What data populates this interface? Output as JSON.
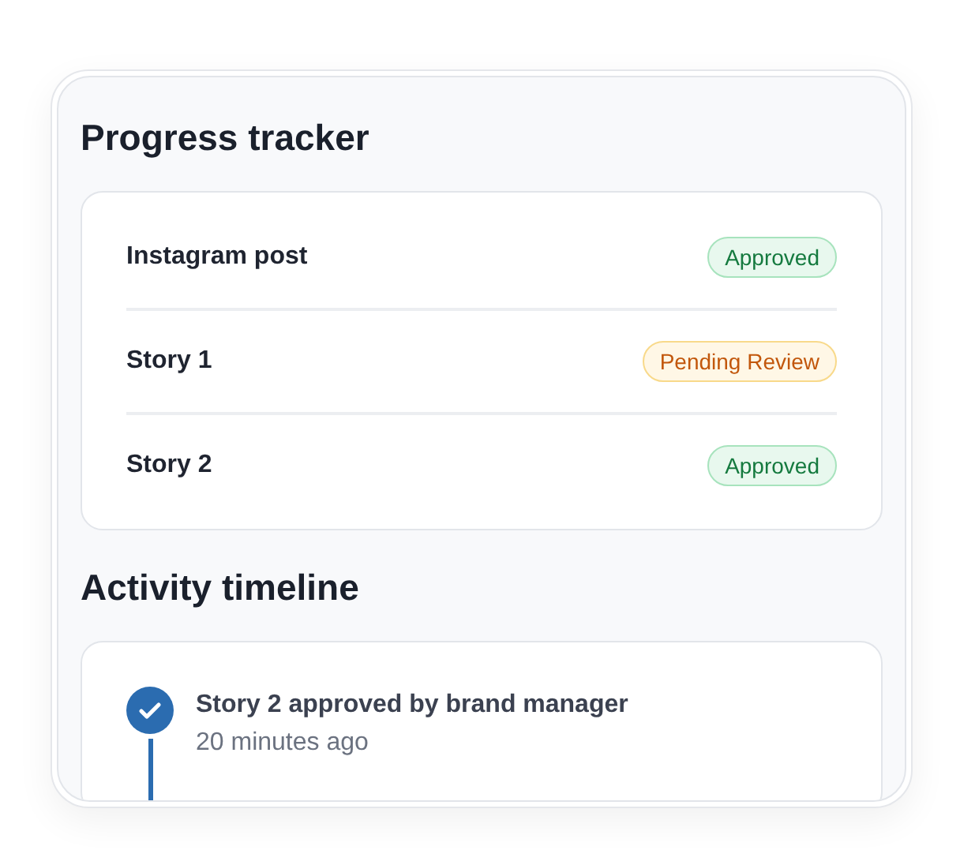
{
  "progress_tracker": {
    "title": "Progress tracker",
    "items": [
      {
        "name": "Instagram post",
        "status": {
          "kind": "approved",
          "label": "Approved"
        }
      },
      {
        "name": "Story 1",
        "status": {
          "kind": "pending",
          "label": "Pending Review"
        }
      },
      {
        "name": "Story 2",
        "status": {
          "kind": "approved",
          "label": "Approved"
        }
      }
    ]
  },
  "activity_timeline": {
    "title": "Activity timeline",
    "events": [
      {
        "kind": "done",
        "text": "Story 2 approved by brand manager",
        "time": "20 minutes ago"
      }
    ]
  }
}
